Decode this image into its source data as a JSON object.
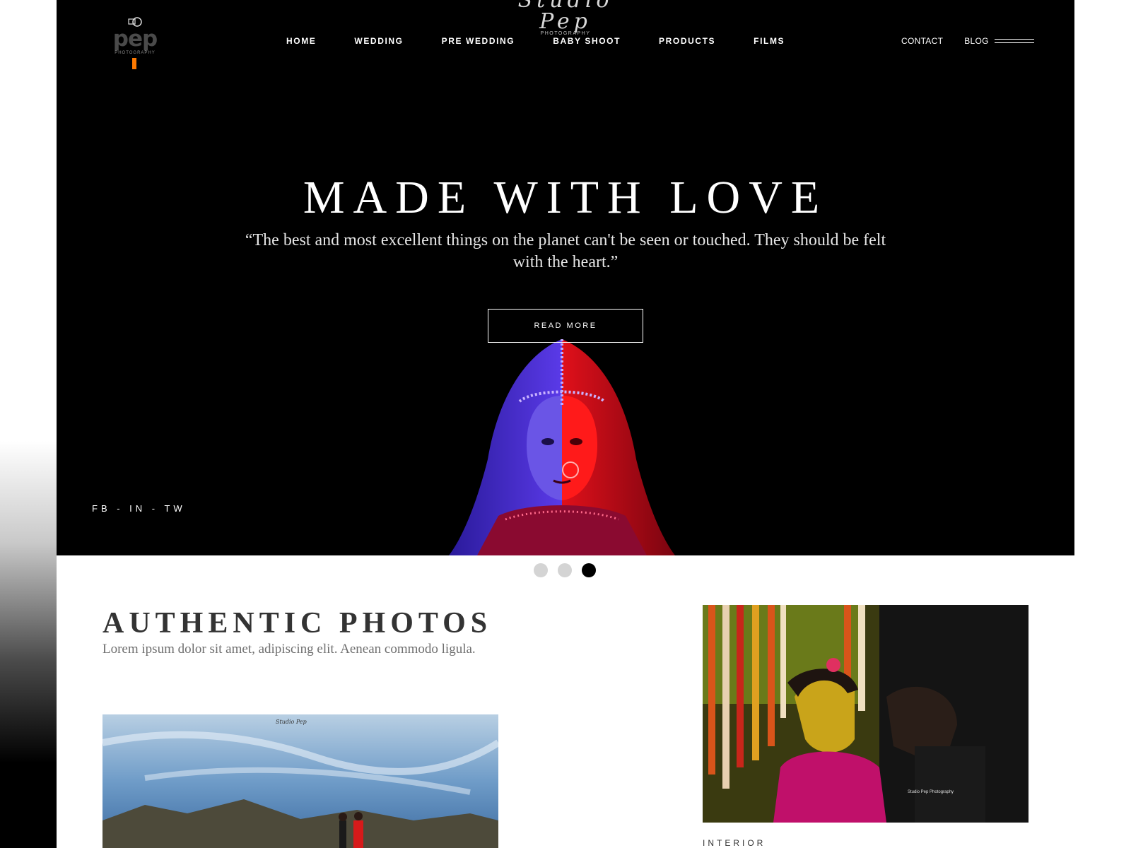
{
  "brand": {
    "script_name": "Studio Pep",
    "script_tagline": "PHOTOGRAPHY",
    "logo_word": "pep",
    "logo_sub": "PHOTOGRAPHY",
    "accent_color": "#ff7a00"
  },
  "nav": {
    "items": [
      {
        "label": "HOME"
      },
      {
        "label": "WEDDING"
      },
      {
        "label": "PRE WEDDING"
      },
      {
        "label": "BABY SHOOT"
      },
      {
        "label": "PRODUCTS"
      },
      {
        "label": "FILMS"
      }
    ],
    "contact_label": "CONTACT",
    "blog_label": "BLOG",
    "menu_icon": "hamburger-lines-icon"
  },
  "hero": {
    "title": "MADE WITH LOVE",
    "quote": "“The best and most excellent things on the planet can't be seen or touched. They should be felt with the heart.”",
    "button_label": "READ MORE",
    "social": "FB - IN - TW"
  },
  "slider": {
    "count": 3,
    "active_index": 3
  },
  "section": {
    "title": "AUTHENTIC PHOTOS",
    "subtitle": "Lorem ipsum dolor sit amet, adipiscing elit. Aenean commodo ligula.",
    "photo1_watermark": "Studio Pep",
    "photo2_watermark": "Studio Pep Photography",
    "card_label": "INTERIOR"
  }
}
